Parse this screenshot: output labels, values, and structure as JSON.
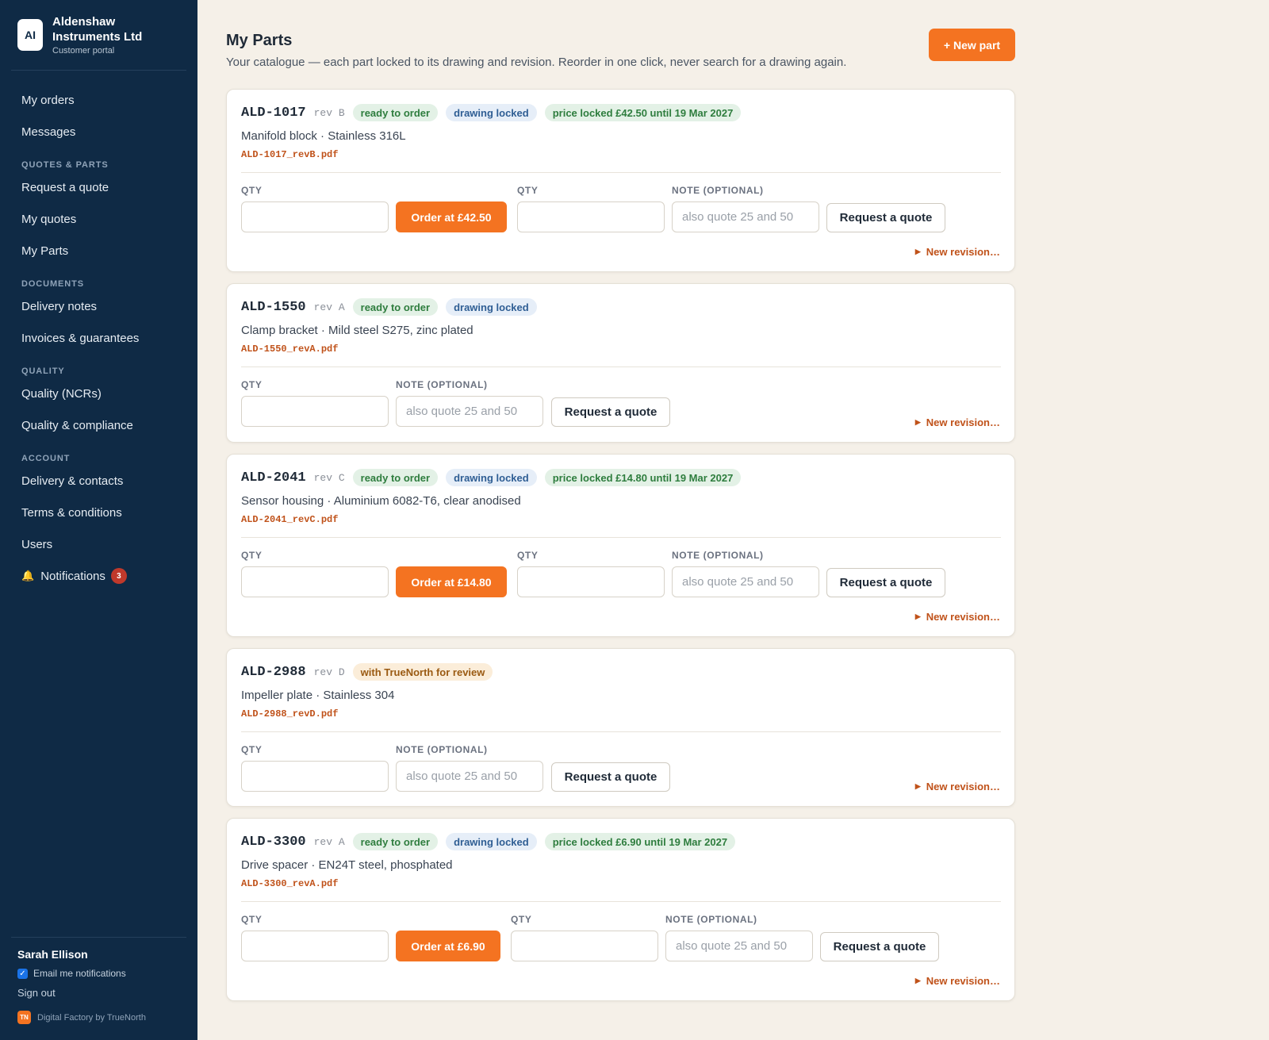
{
  "brand": {
    "logo": "AI",
    "name": "Aldenshaw Instruments Ltd",
    "subtitle": "Customer portal"
  },
  "nav": {
    "my_orders": "My orders",
    "messages": "Messages",
    "section_quotes": "QUOTES & PARTS",
    "request_quote": "Request a quote",
    "my_quotes": "My quotes",
    "my_parts": "My Parts",
    "section_documents": "DOCUMENTS",
    "delivery_notes": "Delivery notes",
    "invoices": "Invoices & guarantees",
    "section_quality": "QUALITY",
    "quality_ncrs": "Quality (NCRs)",
    "quality_compliance": "Quality & compliance",
    "section_account": "ACCOUNT",
    "delivery_contacts": "Delivery & contacts",
    "terms": "Terms & conditions",
    "users": "Users",
    "notifications": "Notifications",
    "notifications_count": "3",
    "bell_icon": "🔔"
  },
  "footer": {
    "user_name": "Sarah Ellison",
    "email_notifications": "Email me notifications",
    "email_checked": true,
    "sign_out": "Sign out",
    "powered_badge": "TN",
    "powered_by": "Digital Factory by TrueNorth"
  },
  "header": {
    "title": "My Parts",
    "subtitle": "Your catalogue — each part locked to its drawing and revision. Reorder in one click, never search for a drawing again.",
    "new_part_button": "+ New part"
  },
  "labels": {
    "qty": "QTY",
    "note": "NOTE (OPTIONAL)",
    "note_placeholder": "also quote 25 and 50",
    "request_quote": "Request a quote",
    "new_revision": "New revision…",
    "new_revision_arrow": "▶"
  },
  "colors": {
    "sidebar": "#0f2a45",
    "accent": "#f47321",
    "background": "#f5f0e8",
    "file_link": "#c0521a"
  },
  "parts": [
    {
      "part_no": "ALD-1017",
      "rev": "rev B",
      "status": "ready to order",
      "drawing": "drawing locked",
      "price_badge": "price locked £42.50 until 19 Mar 2027",
      "description": "Manifold block · Stainless 316L",
      "file": "ALD-1017_revB.pdf",
      "order_button": "Order at £42.50"
    },
    {
      "part_no": "ALD-1550",
      "rev": "rev A",
      "status": "ready to order",
      "drawing": "drawing locked",
      "description": "Clamp bracket · Mild steel S275, zinc plated",
      "file": "ALD-1550_revA.pdf"
    },
    {
      "part_no": "ALD-2041",
      "rev": "rev C",
      "status": "ready to order",
      "drawing": "drawing locked",
      "price_badge": "price locked £14.80 until 19 Mar 2027",
      "description": "Sensor housing · Aluminium 6082-T6, clear anodised",
      "file": "ALD-2041_revC.pdf",
      "order_button": "Order at £14.80"
    },
    {
      "part_no": "ALD-2988",
      "rev": "rev D",
      "status": "with TrueNorth for review",
      "description": "Impeller plate · Stainless 304",
      "file": "ALD-2988_revD.pdf"
    },
    {
      "part_no": "ALD-3300",
      "rev": "rev A",
      "status": "ready to order",
      "drawing": "drawing locked",
      "price_badge": "price locked £6.90 until 19 Mar 2027",
      "description": "Drive spacer · EN24T steel, phosphated",
      "file": "ALD-3300_revA.pdf",
      "order_button": "Order at £6.90"
    }
  ]
}
